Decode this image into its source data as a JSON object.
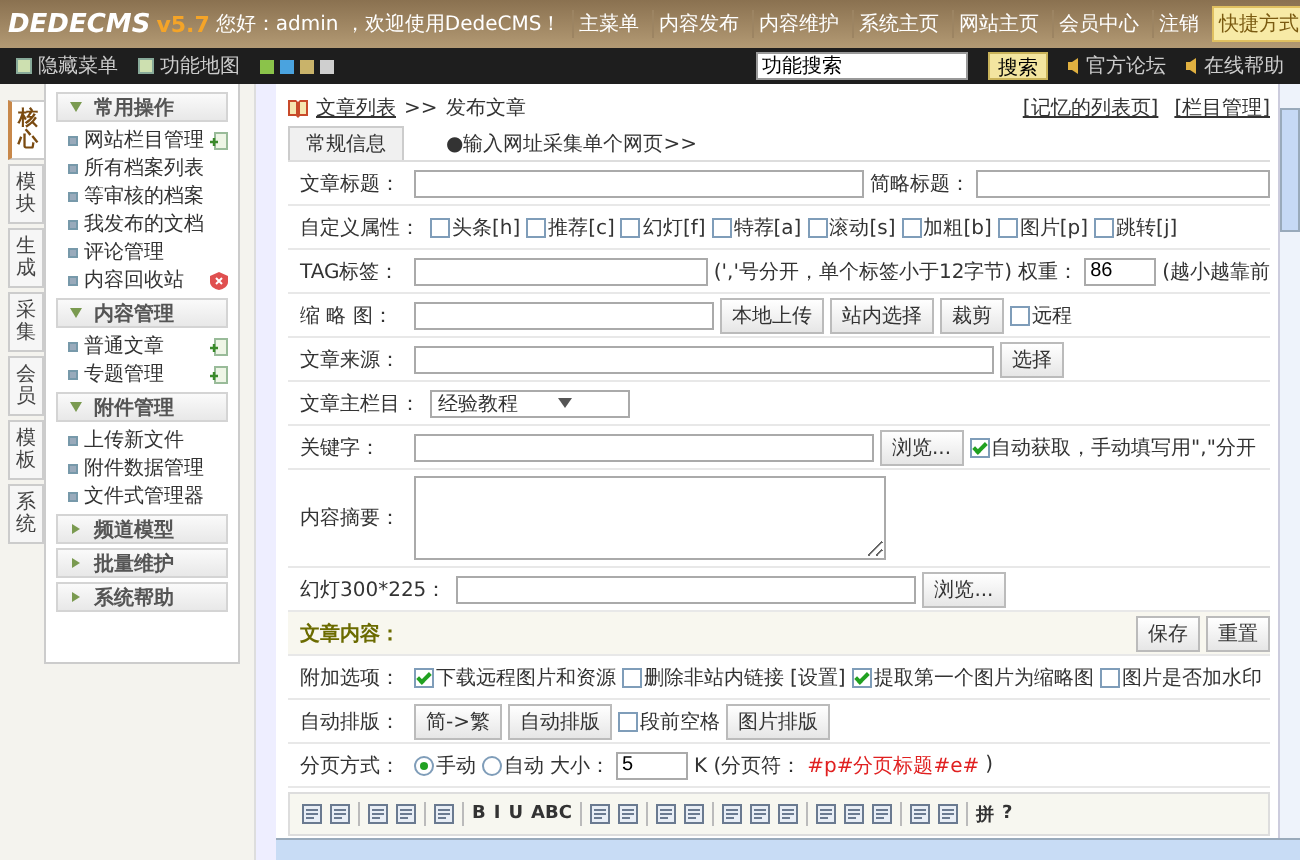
{
  "header": {
    "logo": "DEDECMS",
    "version": "v5.7",
    "greeting": "您好：admin ，欢迎使用DedeCMS！",
    "nav": [
      "主菜单",
      "内容发布",
      "内容维护",
      "系统主页",
      "网站主页",
      "会员中心",
      "注销"
    ],
    "quick": "快捷方式"
  },
  "toolbar": {
    "items": [
      "隐藏菜单",
      "功能地图"
    ],
    "search": {
      "value": "功能搜索"
    },
    "search_button": "搜索",
    "links": [
      "官方论坛",
      "在线帮助"
    ]
  },
  "side_tabs": [
    {
      "label": "核心",
      "selected": true
    },
    {
      "label": "模块",
      "selected": false
    },
    {
      "label": "生成",
      "selected": false
    },
    {
      "label": "采集",
      "selected": false
    },
    {
      "label": "会员",
      "selected": false
    },
    {
      "label": "模板",
      "selected": false
    },
    {
      "label": "系统",
      "selected": false
    }
  ],
  "menu": [
    {
      "title": "常用操作",
      "expanded": true,
      "items": [
        {
          "label": "网站栏目管理",
          "kind": "add"
        },
        {
          "label": "所有档案列表",
          "kind": "plain"
        },
        {
          "label": "等审核的档案",
          "kind": "plain"
        },
        {
          "label": "我发布的文档",
          "kind": "plain"
        },
        {
          "label": "评论管理",
          "kind": "plain"
        },
        {
          "label": "内容回收站",
          "kind": "recycle"
        }
      ]
    },
    {
      "title": "内容管理",
      "expanded": true,
      "items": [
        {
          "label": "普通文章",
          "kind": "add"
        },
        {
          "label": "专题管理",
          "kind": "add"
        }
      ]
    },
    {
      "title": "附件管理",
      "expanded": true,
      "items": [
        {
          "label": "上传新文件",
          "kind": "plain"
        },
        {
          "label": "附件数据管理",
          "kind": "plain"
        },
        {
          "label": "文件式管理器",
          "kind": "plain"
        }
      ]
    },
    {
      "title": "频道模型",
      "expanded": false
    },
    {
      "title": "批量维护",
      "expanded": false
    },
    {
      "title": "系统帮助",
      "expanded": false
    }
  ],
  "main": {
    "breadcrumb": {
      "link": "文章列表",
      "separator": ">>",
      "current": "发布文章"
    },
    "top_links": [
      "[记忆的列表页]",
      "[栏目管理]"
    ],
    "tabs": [
      {
        "label": "常规信息",
        "selected": true
      },
      {
        "label": "●输入网址采集单个网页>>",
        "selected": false
      }
    ],
    "rows": [
      {
        "label": "文章标题：",
        "kind": "field",
        "controls": [
          {
            "kind": "long-field"
          },
          {
            "kind": "text",
            "text": "简略标题："
          },
          {
            "kind": "medium-field"
          }
        ]
      },
      {
        "label": "自定义属性：",
        "kind": "field",
        "controls": [
          {
            "kind": "checkbox",
            "label": "头条[h]",
            "checked": false
          },
          {
            "kind": "checkbox",
            "label": "推荐[c]",
            "checked": false
          },
          {
            "kind": "checkbox",
            "label": "幻灯[f]",
            "checked": false
          },
          {
            "kind": "checkbox",
            "label": "特荐[a]",
            "checked": false
          },
          {
            "kind": "checkbox",
            "label": "滚动[s]",
            "checked": false
          },
          {
            "kind": "checkbox",
            "label": "加粗[b]",
            "checked": false
          },
          {
            "kind": "checkbox",
            "label": "图片[p]",
            "checked": false
          },
          {
            "kind": "checkbox",
            "label": "跳转[j]",
            "checked": false
          }
        ]
      },
      {
        "label": "TAG标签：",
        "kind": "field",
        "controls": [
          {
            "kind": "long-field"
          },
          {
            "kind": "text",
            "text": "(','号分开，单个标签小于12字节)"
          },
          {
            "kind": "text",
            "text": "权重："
          },
          {
            "kind": "number-field",
            "value": "86"
          },
          {
            "kind": "text",
            "text": "(越小越靠前"
          }
        ]
      },
      {
        "label": "缩 略 图：",
        "kind": "field",
        "controls": [
          {
            "kind": "medium-field"
          },
          {
            "kind": "button",
            "label": "本地上传"
          },
          {
            "kind": "button",
            "label": "站内选择"
          },
          {
            "kind": "button",
            "label": "裁剪"
          },
          {
            "kind": "checkbox",
            "label": "远程",
            "checked": false
          }
        ]
      },
      {
        "label": "文章来源：",
        "kind": "field",
        "controls": [
          {
            "kind": "wide-field"
          },
          {
            "kind": "button",
            "label": "选择"
          }
        ]
      },
      {
        "label": "文章主栏目：",
        "kind": "field",
        "controls": [
          {
            "kind": "select",
            "value": "经验教程"
          }
        ]
      },
      {
        "label": "关键字：",
        "kind": "field",
        "controls": [
          {
            "kind": "long-field"
          },
          {
            "kind": "button",
            "label": "浏览..."
          },
          {
            "kind": "checkbox",
            "label": "自动获取，手动填写用\",\"分开",
            "checked": true
          }
        ]
      },
      {
        "label": "内容摘要：",
        "kind": "field",
        "controls": [
          {
            "kind": "textarea"
          }
        ]
      },
      {
        "label": "幻灯300*225：",
        "kind": "field",
        "controls": [
          {
            "kind": "long-field"
          },
          {
            "kind": "button",
            "label": "浏览..."
          }
        ]
      },
      {
        "label": "文章内容：",
        "kind": "section",
        "controls": [
          {
            "kind": "button",
            "label": "保存"
          },
          {
            "kind": "button",
            "label": "重置"
          }
        ]
      },
      {
        "label": "附加选项：",
        "kind": "field",
        "controls": [
          {
            "kind": "checkbox",
            "label": "下载远程图片和资源",
            "checked": true
          },
          {
            "kind": "checkbox",
            "label": "删除非站内链接",
            "checked": false
          },
          {
            "kind": "text",
            "text": "[设置]"
          },
          {
            "kind": "checkbox",
            "label": "提取第一个图片为缩略图",
            "checked": true
          },
          {
            "kind": "checkbox",
            "label": "图片是否加水印",
            "checked": false
          }
        ]
      },
      {
        "label": "自动排版：",
        "kind": "field",
        "controls": [
          {
            "kind": "button",
            "label": "简->繁"
          },
          {
            "kind": "button",
            "label": "自动排版"
          },
          {
            "kind": "checkbox",
            "label": "段前空格",
            "checked": false
          },
          {
            "kind": "button",
            "label": "图片排版"
          }
        ]
      },
      {
        "label": "分页方式：",
        "kind": "field",
        "controls": [
          {
            "kind": "radio",
            "label": "手动",
            "selected": true
          },
          {
            "kind": "radio",
            "label": "自动",
            "selected": false
          },
          {
            "kind": "text",
            "text": "大小："
          },
          {
            "kind": "number-field",
            "value": "5"
          },
          {
            "kind": "text",
            "text": "K (分页符："
          },
          {
            "kind": "note",
            "text": "#p#分页标题#e#"
          },
          {
            "kind": "text",
            "text": ")"
          }
        ]
      }
    ],
    "editor_toolbar": [
      {
        "kind": "icon"
      },
      {
        "kind": "icon"
      },
      {
        "kind": "sep"
      },
      {
        "kind": "icon"
      },
      {
        "kind": "icon"
      },
      {
        "kind": "sep"
      },
      {
        "kind": "icon"
      },
      {
        "kind": "sep"
      },
      {
        "kind": "glyph",
        "label": "B"
      },
      {
        "kind": "glyph",
        "label": "I"
      },
      {
        "kind": "glyph",
        "label": "U"
      },
      {
        "kind": "glyph",
        "label": "ABC"
      },
      {
        "kind": "sep"
      },
      {
        "kind": "icon"
      },
      {
        "kind": "icon"
      },
      {
        "kind": "sep"
      },
      {
        "kind": "icon"
      },
      {
        "kind": "icon"
      },
      {
        "kind": "sep"
      },
      {
        "kind": "icon"
      },
      {
        "kind": "icon"
      },
      {
        "kind": "icon"
      },
      {
        "kind": "sep"
      },
      {
        "kind": "icon"
      },
      {
        "kind": "icon"
      },
      {
        "kind": "icon"
      },
      {
        "kind": "sep"
      },
      {
        "kind": "icon"
      },
      {
        "kind": "icon"
      },
      {
        "kind": "sep"
      },
      {
        "kind": "glyph",
        "label": "拼"
      },
      {
        "kind": "glyph",
        "label": "?"
      }
    ]
  }
}
